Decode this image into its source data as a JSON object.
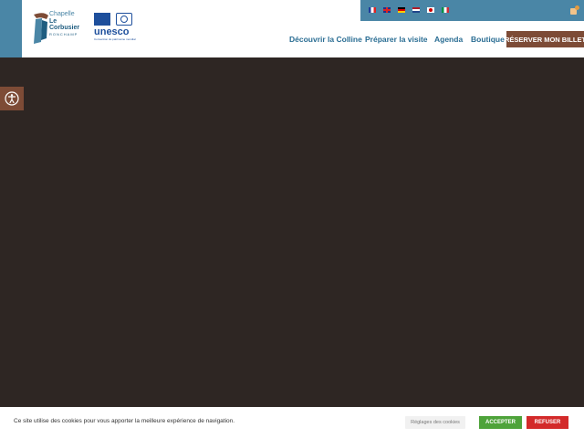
{
  "brand": {
    "logo_line1": "Chapelle",
    "logo_line2": "Le Corbusier",
    "logo_line3": "RONCHAMP",
    "unesco_word": "unesco",
    "unesco_sub": "Convention du patrimoine mondial"
  },
  "languages": [
    {
      "code": "fr",
      "icon": "flag-france-icon"
    },
    {
      "code": "en",
      "icon": "flag-uk-icon"
    },
    {
      "code": "de",
      "icon": "flag-germany-icon"
    },
    {
      "code": "nl",
      "icon": "flag-netherlands-icon"
    },
    {
      "code": "ja",
      "icon": "flag-japan-icon"
    },
    {
      "code": "it",
      "icon": "flag-italy-icon"
    }
  ],
  "nav": {
    "item1": "Découvrir la Colline",
    "item2": "Préparer la visite",
    "item3": "Agenda",
    "item4": "Boutique"
  },
  "header": {
    "book_button": "RÉSERVER MON BILLET",
    "cart_icon": "shopping-bag-icon"
  },
  "accessibility": {
    "icon": "accessibility-icon"
  },
  "cookie": {
    "message": "Ce site utilise des cookies pour vous apporter la meilleure expérience de navigation.",
    "settings_label": "Réglages des cookies",
    "accept_label": "ACCEPTER",
    "refuse_label": "REFUSER"
  },
  "colors": {
    "primary_blue": "#4a86a6",
    "brown_accent": "#7d4b36",
    "hero_background": "#2e2623",
    "accept_green": "#4ea33a",
    "refuse_red": "#d32a2a"
  }
}
